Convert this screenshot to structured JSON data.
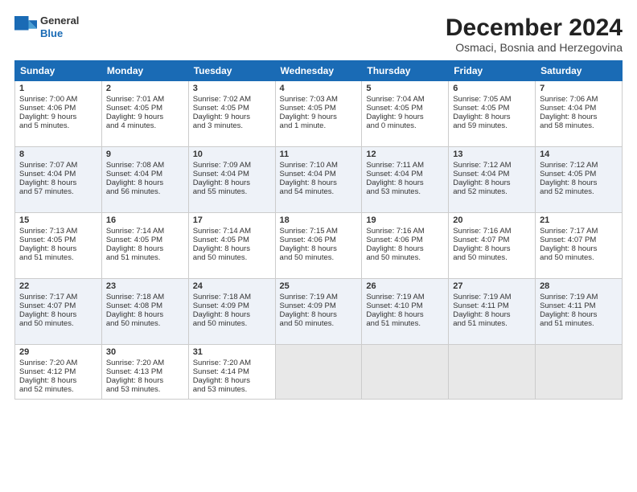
{
  "header": {
    "logo_line1": "General",
    "logo_line2": "Blue",
    "month": "December 2024",
    "location": "Osmaci, Bosnia and Herzegovina"
  },
  "days_of_week": [
    "Sunday",
    "Monday",
    "Tuesday",
    "Wednesday",
    "Thursday",
    "Friday",
    "Saturday"
  ],
  "weeks": [
    [
      {
        "day": 1,
        "lines": [
          "Sunrise: 7:00 AM",
          "Sunset: 4:06 PM",
          "Daylight: 9 hours",
          "and 5 minutes."
        ]
      },
      {
        "day": 2,
        "lines": [
          "Sunrise: 7:01 AM",
          "Sunset: 4:05 PM",
          "Daylight: 9 hours",
          "and 4 minutes."
        ]
      },
      {
        "day": 3,
        "lines": [
          "Sunrise: 7:02 AM",
          "Sunset: 4:05 PM",
          "Daylight: 9 hours",
          "and 3 minutes."
        ]
      },
      {
        "day": 4,
        "lines": [
          "Sunrise: 7:03 AM",
          "Sunset: 4:05 PM",
          "Daylight: 9 hours",
          "and 1 minute."
        ]
      },
      {
        "day": 5,
        "lines": [
          "Sunrise: 7:04 AM",
          "Sunset: 4:05 PM",
          "Daylight: 9 hours",
          "and 0 minutes."
        ]
      },
      {
        "day": 6,
        "lines": [
          "Sunrise: 7:05 AM",
          "Sunset: 4:05 PM",
          "Daylight: 8 hours",
          "and 59 minutes."
        ]
      },
      {
        "day": 7,
        "lines": [
          "Sunrise: 7:06 AM",
          "Sunset: 4:04 PM",
          "Daylight: 8 hours",
          "and 58 minutes."
        ]
      }
    ],
    [
      {
        "day": 8,
        "lines": [
          "Sunrise: 7:07 AM",
          "Sunset: 4:04 PM",
          "Daylight: 8 hours",
          "and 57 minutes."
        ]
      },
      {
        "day": 9,
        "lines": [
          "Sunrise: 7:08 AM",
          "Sunset: 4:04 PM",
          "Daylight: 8 hours",
          "and 56 minutes."
        ]
      },
      {
        "day": 10,
        "lines": [
          "Sunrise: 7:09 AM",
          "Sunset: 4:04 PM",
          "Daylight: 8 hours",
          "and 55 minutes."
        ]
      },
      {
        "day": 11,
        "lines": [
          "Sunrise: 7:10 AM",
          "Sunset: 4:04 PM",
          "Daylight: 8 hours",
          "and 54 minutes."
        ]
      },
      {
        "day": 12,
        "lines": [
          "Sunrise: 7:11 AM",
          "Sunset: 4:04 PM",
          "Daylight: 8 hours",
          "and 53 minutes."
        ]
      },
      {
        "day": 13,
        "lines": [
          "Sunrise: 7:12 AM",
          "Sunset: 4:04 PM",
          "Daylight: 8 hours",
          "and 52 minutes."
        ]
      },
      {
        "day": 14,
        "lines": [
          "Sunrise: 7:12 AM",
          "Sunset: 4:05 PM",
          "Daylight: 8 hours",
          "and 52 minutes."
        ]
      }
    ],
    [
      {
        "day": 15,
        "lines": [
          "Sunrise: 7:13 AM",
          "Sunset: 4:05 PM",
          "Daylight: 8 hours",
          "and 51 minutes."
        ]
      },
      {
        "day": 16,
        "lines": [
          "Sunrise: 7:14 AM",
          "Sunset: 4:05 PM",
          "Daylight: 8 hours",
          "and 51 minutes."
        ]
      },
      {
        "day": 17,
        "lines": [
          "Sunrise: 7:14 AM",
          "Sunset: 4:05 PM",
          "Daylight: 8 hours",
          "and 50 minutes."
        ]
      },
      {
        "day": 18,
        "lines": [
          "Sunrise: 7:15 AM",
          "Sunset: 4:06 PM",
          "Daylight: 8 hours",
          "and 50 minutes."
        ]
      },
      {
        "day": 19,
        "lines": [
          "Sunrise: 7:16 AM",
          "Sunset: 4:06 PM",
          "Daylight: 8 hours",
          "and 50 minutes."
        ]
      },
      {
        "day": 20,
        "lines": [
          "Sunrise: 7:16 AM",
          "Sunset: 4:07 PM",
          "Daylight: 8 hours",
          "and 50 minutes."
        ]
      },
      {
        "day": 21,
        "lines": [
          "Sunrise: 7:17 AM",
          "Sunset: 4:07 PM",
          "Daylight: 8 hours",
          "and 50 minutes."
        ]
      }
    ],
    [
      {
        "day": 22,
        "lines": [
          "Sunrise: 7:17 AM",
          "Sunset: 4:07 PM",
          "Daylight: 8 hours",
          "and 50 minutes."
        ]
      },
      {
        "day": 23,
        "lines": [
          "Sunrise: 7:18 AM",
          "Sunset: 4:08 PM",
          "Daylight: 8 hours",
          "and 50 minutes."
        ]
      },
      {
        "day": 24,
        "lines": [
          "Sunrise: 7:18 AM",
          "Sunset: 4:09 PM",
          "Daylight: 8 hours",
          "and 50 minutes."
        ]
      },
      {
        "day": 25,
        "lines": [
          "Sunrise: 7:19 AM",
          "Sunset: 4:09 PM",
          "Daylight: 8 hours",
          "and 50 minutes."
        ]
      },
      {
        "day": 26,
        "lines": [
          "Sunrise: 7:19 AM",
          "Sunset: 4:10 PM",
          "Daylight: 8 hours",
          "and 51 minutes."
        ]
      },
      {
        "day": 27,
        "lines": [
          "Sunrise: 7:19 AM",
          "Sunset: 4:11 PM",
          "Daylight: 8 hours",
          "and 51 minutes."
        ]
      },
      {
        "day": 28,
        "lines": [
          "Sunrise: 7:19 AM",
          "Sunset: 4:11 PM",
          "Daylight: 8 hours",
          "and 51 minutes."
        ]
      }
    ],
    [
      {
        "day": 29,
        "lines": [
          "Sunrise: 7:20 AM",
          "Sunset: 4:12 PM",
          "Daylight: 8 hours",
          "and 52 minutes."
        ]
      },
      {
        "day": 30,
        "lines": [
          "Sunrise: 7:20 AM",
          "Sunset: 4:13 PM",
          "Daylight: 8 hours",
          "and 53 minutes."
        ]
      },
      {
        "day": 31,
        "lines": [
          "Sunrise: 7:20 AM",
          "Sunset: 4:14 PM",
          "Daylight: 8 hours",
          "and 53 minutes."
        ]
      },
      null,
      null,
      null,
      null
    ]
  ]
}
